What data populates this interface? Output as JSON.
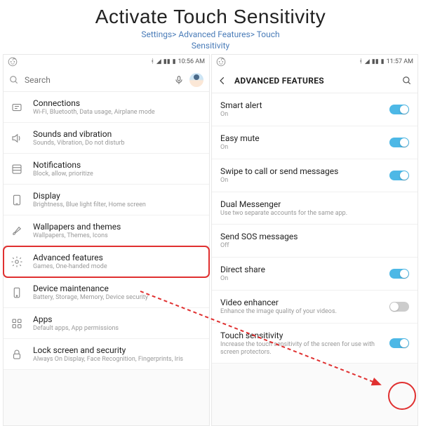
{
  "header": {
    "title": "Activate Touch Sensitivity",
    "breadcrumb_line1": "Settings> Advanced Features> Touch",
    "breadcrumb_line2": "Sensitivity"
  },
  "left_screen": {
    "status": {
      "time": "10:56 AM"
    },
    "search_placeholder": "Search",
    "items": [
      {
        "title": "Connections",
        "sub": "Wi-Fi, Bluetooth, Data usage, Airplane mode"
      },
      {
        "title": "Sounds and vibration",
        "sub": "Sounds, Vibration, Do not disturb"
      },
      {
        "title": "Notifications",
        "sub": "Block, allow, prioritize"
      },
      {
        "title": "Display",
        "sub": "Brightness, Blue light filter, Home screen"
      },
      {
        "title": "Wallpapers and themes",
        "sub": "Wallpapers, Themes, Icons"
      },
      {
        "title": "Advanced features",
        "sub": "Games, One-handed mode"
      },
      {
        "title": "Device maintenance",
        "sub": "Battery, Storage, Memory, Device security"
      },
      {
        "title": "Apps",
        "sub": "Default apps, App permissions"
      },
      {
        "title": "Lock screen and security",
        "sub": "Always On Display, Face Recognition, Fingerprints, Iris"
      }
    ]
  },
  "right_screen": {
    "status": {
      "time": "11:57 AM"
    },
    "header_title": "ADVANCED FEATURES",
    "items": [
      {
        "title": "Smart alert",
        "sub": "On",
        "toggle": "on"
      },
      {
        "title": "Easy mute",
        "sub": "On",
        "toggle": "on"
      },
      {
        "title": "Swipe to call or send messages",
        "sub": "On",
        "toggle": "on"
      },
      {
        "title": "Dual Messenger",
        "sub": "Use two separate accounts for the same app.",
        "toggle": null
      },
      {
        "title": "Send SOS messages",
        "sub": "Off",
        "toggle": null
      },
      {
        "title": "Direct share",
        "sub": "On",
        "toggle": "on"
      },
      {
        "title": "Video enhancer",
        "sub": "Enhance the image quality of your videos.",
        "toggle": "off"
      },
      {
        "title": "Touch sensitivity",
        "sub": "Increase the touch sensitivity of the screen for use with screen protectors.",
        "toggle": "on"
      }
    ]
  }
}
